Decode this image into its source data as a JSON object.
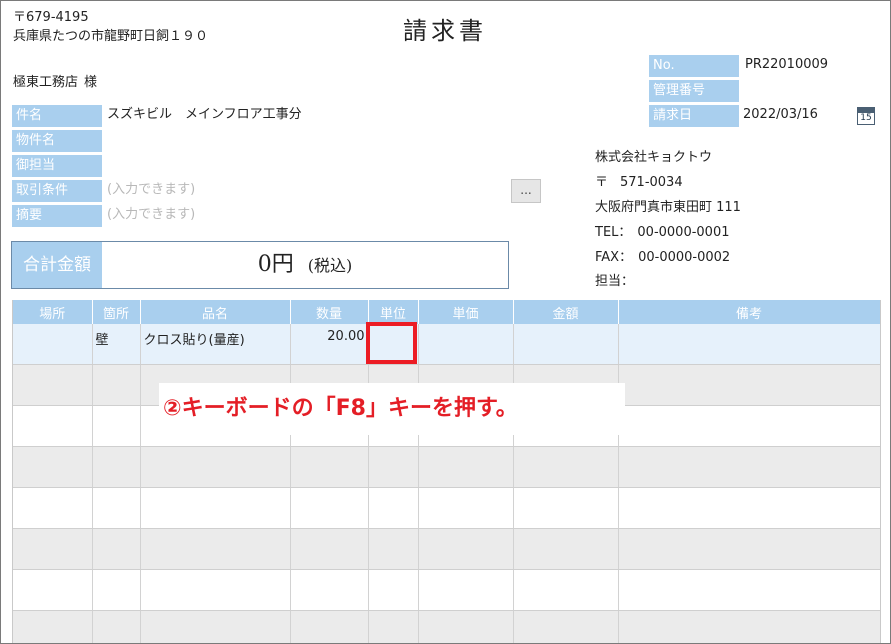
{
  "document": {
    "title": "請求書",
    "sender_postal": "〒679-4195",
    "sender_address": "兵庫県たつの市龍野町日飼１９０"
  },
  "customer": {
    "name": "極東工務店",
    "suffix": "様"
  },
  "meta": {
    "no_label": "No.",
    "no_value": "PR22010009",
    "mgmt_label": "管理番号",
    "mgmt_value": "",
    "date_label": "請求日",
    "date_value": "2022/03/16",
    "calendar_icon_text": "15"
  },
  "fields": [
    {
      "label": "件名",
      "value": "スズキビル　メインフロア工事分",
      "placeholder": false
    },
    {
      "label": "物件名",
      "value": "",
      "placeholder": false
    },
    {
      "label": "御担当",
      "value": "",
      "placeholder": false
    },
    {
      "label": "取引条件",
      "value": "(入力できます)",
      "placeholder": true
    },
    {
      "label": "摘要",
      "value": "(入力できます)",
      "placeholder": true
    }
  ],
  "ellipsis_button": "...",
  "company": {
    "name": "株式会社キョクトウ",
    "postal_mark": "〒",
    "postal": "571-0034",
    "address": "大阪府門真市東田町 111",
    "tel_label": "TEL：",
    "tel": "00-0000-0001",
    "fax_label": "FAX：",
    "fax": "00-0000-0002",
    "person_label": "担当："
  },
  "total": {
    "label": "合計金額",
    "value": "0円",
    "tax_note": "(税込)"
  },
  "table": {
    "headers": [
      "場所",
      "箇所",
      "品名",
      "数量",
      "単位",
      "単価",
      "金額",
      "備考"
    ],
    "rows": [
      [
        "",
        "壁",
        "クロス貼り(量産)",
        "20.00",
        "",
        "",
        "",
        ""
      ],
      [
        "",
        "",
        "",
        "",
        "",
        "",
        "",
        ""
      ],
      [
        "",
        "",
        "",
        "",
        "",
        "",
        "",
        ""
      ],
      [
        "",
        "",
        "",
        "",
        "",
        "",
        "",
        ""
      ],
      [
        "",
        "",
        "",
        "",
        "",
        "",
        "",
        ""
      ],
      [
        "",
        "",
        "",
        "",
        "",
        "",
        "",
        ""
      ],
      [
        "",
        "",
        "",
        "",
        "",
        "",
        "",
        ""
      ],
      [
        "",
        "",
        "",
        "",
        "",
        "",
        "",
        ""
      ]
    ]
  },
  "annotation": {
    "instruction": "②キーボードの「F8」キーを押す。"
  },
  "colors": {
    "label_bg": "#a9cfee",
    "highlight": "#ec1c24",
    "instruction_text": "#e41e26"
  }
}
